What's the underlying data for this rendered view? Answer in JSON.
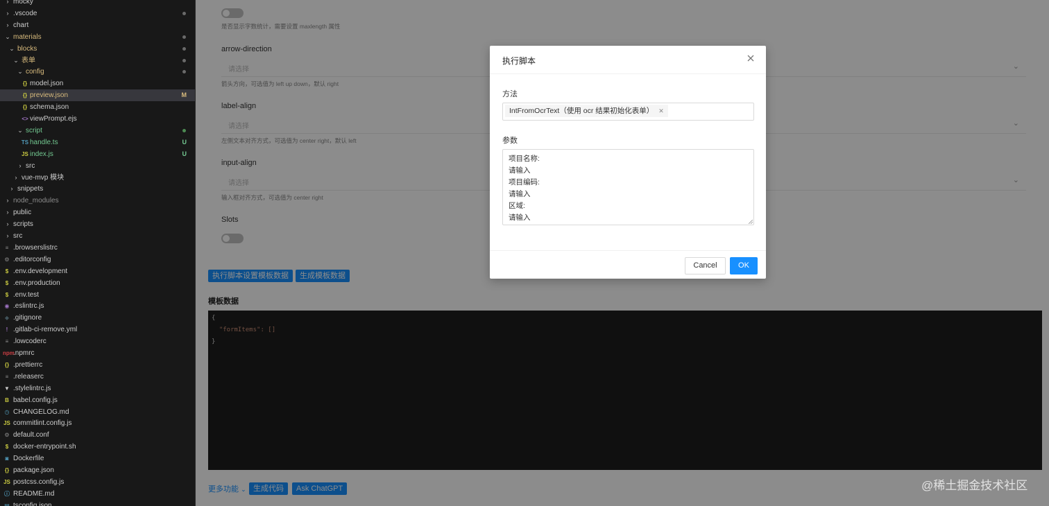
{
  "explorer": {
    "items": [
      {
        "label": "mocky",
        "depth": 0,
        "kind": "folder",
        "open": false,
        "icon": "folder",
        "decoration": "",
        "color": "#cccccc"
      },
      {
        "label": ".vscode",
        "depth": 0,
        "kind": "folder",
        "open": false,
        "icon": "folder",
        "decoration": "dot",
        "color": "#cccccc"
      },
      {
        "label": "chart",
        "depth": 0,
        "kind": "folder",
        "open": false,
        "icon": "folder",
        "decoration": "",
        "color": "#cccccc"
      },
      {
        "label": "materials",
        "depth": 0,
        "kind": "folder",
        "open": true,
        "icon": "folder",
        "decoration": "dot",
        "color": "#d7ba7d"
      },
      {
        "label": "blocks",
        "depth": 1,
        "kind": "folder",
        "open": true,
        "icon": "folder",
        "decoration": "dot",
        "color": "#d7ba7d"
      },
      {
        "label": "表单",
        "depth": 2,
        "kind": "folder",
        "open": true,
        "icon": "folder",
        "decoration": "dot",
        "color": "#d7ba7d"
      },
      {
        "label": "config",
        "depth": 3,
        "kind": "folder",
        "open": true,
        "icon": "folder",
        "decoration": "dot",
        "color": "#d7ba7d"
      },
      {
        "label": "model.json",
        "depth": 4,
        "kind": "file",
        "icon": "json",
        "decoration": "",
        "color": "#cccccc"
      },
      {
        "label": "preview.json",
        "depth": 4,
        "kind": "file",
        "icon": "json",
        "decoration": "M",
        "color": "#d7ba7d",
        "selected": true
      },
      {
        "label": "schema.json",
        "depth": 4,
        "kind": "file",
        "icon": "json",
        "decoration": "",
        "color": "#cccccc"
      },
      {
        "label": "viewPrompt.ejs",
        "depth": 4,
        "kind": "file",
        "icon": "ejs",
        "decoration": "",
        "color": "#cccccc"
      },
      {
        "label": "script",
        "depth": 3,
        "kind": "folder",
        "open": true,
        "icon": "folder",
        "decoration": "dot-green",
        "color": "#73c991"
      },
      {
        "label": "handle.ts",
        "depth": 4,
        "kind": "file",
        "icon": "ts",
        "decoration": "U",
        "color": "#73c991"
      },
      {
        "label": "index.js",
        "depth": 4,
        "kind": "file",
        "icon": "js",
        "decoration": "U",
        "color": "#73c991"
      },
      {
        "label": "src",
        "depth": 3,
        "kind": "folder",
        "open": false,
        "icon": "folder",
        "decoration": "",
        "color": "#cccccc"
      },
      {
        "label": "vue-mvp 模块",
        "depth": 2,
        "kind": "folder",
        "open": false,
        "icon": "folder",
        "decoration": "",
        "color": "#cccccc"
      },
      {
        "label": "snippets",
        "depth": 1,
        "kind": "folder",
        "open": false,
        "icon": "folder",
        "decoration": "",
        "color": "#cccccc"
      },
      {
        "label": "node_modules",
        "depth": 0,
        "kind": "folder",
        "open": false,
        "icon": "folder",
        "decoration": "",
        "color": "#8c8c8c"
      },
      {
        "label": "public",
        "depth": 0,
        "kind": "folder",
        "open": false,
        "icon": "folder",
        "decoration": "",
        "color": "#cccccc"
      },
      {
        "label": "scripts",
        "depth": 0,
        "kind": "folder",
        "open": false,
        "icon": "folder",
        "decoration": "",
        "color": "#cccccc"
      },
      {
        "label": "src",
        "depth": 0,
        "kind": "folder",
        "open": false,
        "icon": "folder",
        "decoration": "",
        "color": "#cccccc"
      },
      {
        "label": ".browserslistrc",
        "depth": 0,
        "kind": "file",
        "icon": "lines",
        "decoration": "",
        "color": "#cccccc"
      },
      {
        "label": ".editorconfig",
        "depth": 0,
        "kind": "file",
        "icon": "gear",
        "decoration": "",
        "color": "#cccccc"
      },
      {
        "label": ".env.development",
        "depth": 0,
        "kind": "file",
        "icon": "dollar",
        "decoration": "",
        "color": "#cccccc"
      },
      {
        "label": ".env.production",
        "depth": 0,
        "kind": "file",
        "icon": "dollar",
        "decoration": "",
        "color": "#cccccc"
      },
      {
        "label": ".env.test",
        "depth": 0,
        "kind": "file",
        "icon": "dollar",
        "decoration": "",
        "color": "#cccccc"
      },
      {
        "label": ".eslintrc.js",
        "depth": 0,
        "kind": "file",
        "icon": "eslint",
        "decoration": "",
        "color": "#cccccc"
      },
      {
        "label": ".gitignore",
        "depth": 0,
        "kind": "file",
        "icon": "git",
        "decoration": "",
        "color": "#cccccc"
      },
      {
        "label": ".gitlab-ci-remove.yml",
        "depth": 0,
        "kind": "file",
        "icon": "yml",
        "decoration": "",
        "color": "#cccccc"
      },
      {
        "label": ".lowcoderc",
        "depth": 0,
        "kind": "file",
        "icon": "lines",
        "decoration": "",
        "color": "#cccccc"
      },
      {
        "label": ".npmrc",
        "depth": 0,
        "kind": "file",
        "icon": "npm",
        "decoration": "",
        "color": "#cccccc"
      },
      {
        "label": ".prettierrc",
        "depth": 0,
        "kind": "file",
        "icon": "json",
        "decoration": "",
        "color": "#cccccc"
      },
      {
        "label": ".releaserc",
        "depth": 0,
        "kind": "file",
        "icon": "lines",
        "decoration": "",
        "color": "#cccccc"
      },
      {
        "label": ".stylelintrc.js",
        "depth": 0,
        "kind": "file",
        "icon": "stylelint",
        "decoration": "",
        "color": "#cccccc"
      },
      {
        "label": "babel.config.js",
        "depth": 0,
        "kind": "file",
        "icon": "babel",
        "decoration": "",
        "color": "#cccccc"
      },
      {
        "label": "CHANGELOG.md",
        "depth": 0,
        "kind": "file",
        "icon": "changelog",
        "decoration": "",
        "color": "#cccccc"
      },
      {
        "label": "commitlint.config.js",
        "depth": 0,
        "kind": "file",
        "icon": "js",
        "decoration": "",
        "color": "#cccccc"
      },
      {
        "label": "default.conf",
        "depth": 0,
        "kind": "file",
        "icon": "gear",
        "decoration": "",
        "color": "#cccccc"
      },
      {
        "label": "docker-entrypoint.sh",
        "depth": 0,
        "kind": "file",
        "icon": "dollar",
        "decoration": "",
        "color": "#cccccc"
      },
      {
        "label": "Dockerfile",
        "depth": 0,
        "kind": "file",
        "icon": "docker",
        "decoration": "",
        "color": "#cccccc"
      },
      {
        "label": "package.json",
        "depth": 0,
        "kind": "file",
        "icon": "json",
        "decoration": "",
        "color": "#cccccc"
      },
      {
        "label": "postcss.config.js",
        "depth": 0,
        "kind": "file",
        "icon": "js",
        "decoration": "",
        "color": "#cccccc"
      },
      {
        "label": "README.md",
        "depth": 0,
        "kind": "file",
        "icon": "info",
        "decoration": "",
        "color": "#cccccc"
      },
      {
        "label": "tsconfig.json",
        "depth": 0,
        "kind": "file",
        "icon": "tsconfig",
        "decoration": "",
        "color": "#cccccc"
      }
    ]
  },
  "form": {
    "word_limit_help": "是否显示字数统计，需要设置 maxlength 属性",
    "props": [
      {
        "label": "arrow-direction",
        "placeholder": "请选择",
        "help": "箭头方向，可选值为 left up down，默认 right"
      },
      {
        "label": "label-align",
        "placeholder": "请选择",
        "help": "左侧文本对齐方式，可选值为 center right，默认 left"
      },
      {
        "label": "input-align",
        "placeholder": "请选择",
        "help": "输入框对齐方式，可选值为 center right"
      }
    ],
    "slots_label": "Slots",
    "buttons": {
      "run_script": "执行脚本设置模板数据",
      "generate_template": "生成模板数据"
    },
    "template_title": "模板数据",
    "code_lines": [
      "{",
      "  \"formItems\": []",
      "}"
    ],
    "bottom": {
      "more": "更多功能",
      "generate_code": "生成代码",
      "ask_chatgpt": "Ask ChatGPT"
    }
  },
  "modal": {
    "title": "执行脚本",
    "method_label": "方法",
    "method_value": "IntFromOcrText（使用 ocr 结果初始化表单）",
    "params_label": "参数",
    "params_lines": [
      "项目名称:",
      "请输入",
      "项目编码:",
      "请输入",
      "区域:",
      "请输入"
    ],
    "cancel_label": "Cancel",
    "ok_label": "OK"
  },
  "watermark": "@稀土掘金技术社区",
  "colors": {
    "primary": "#1890ff",
    "sidebar_bg": "#181818",
    "modified": "#d7ba7d",
    "untracked": "#73c991"
  }
}
